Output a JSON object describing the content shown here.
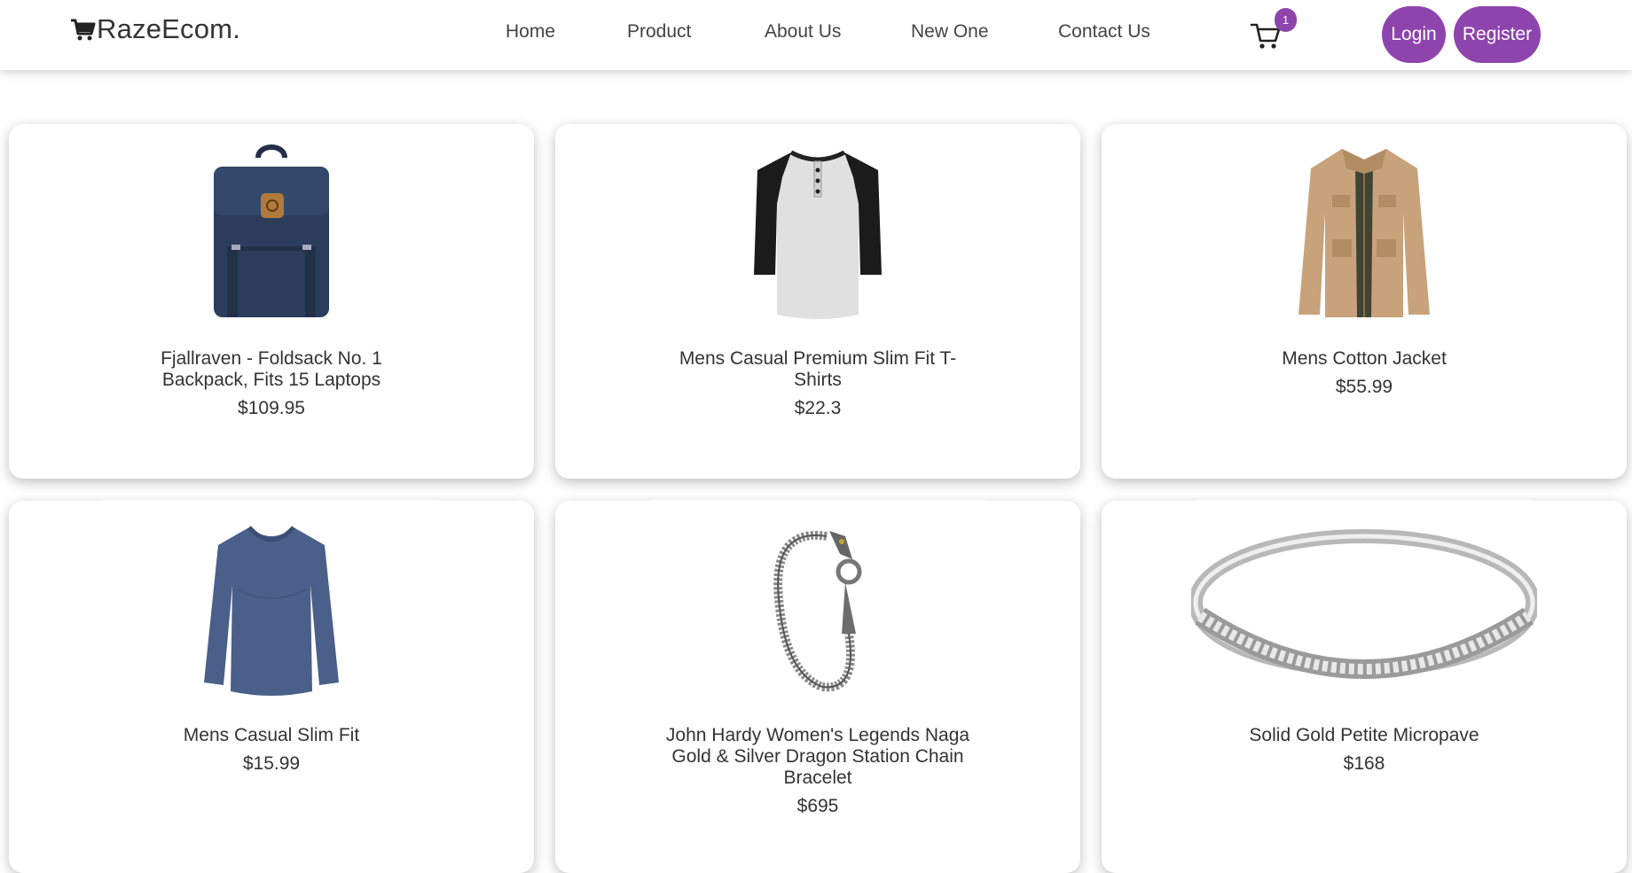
{
  "brand": {
    "name": "RazeEcom.",
    "icon": "shopping-cart-icon"
  },
  "nav": {
    "links": [
      "Home",
      "Product",
      "About Us",
      "New One",
      "Contact Us"
    ]
  },
  "cart": {
    "icon": "shopping-cart-icon",
    "count": "1"
  },
  "auth": {
    "login_label": "Login",
    "register_label": "Register"
  },
  "colors": {
    "accent": "#8e44ad",
    "text": "#333333",
    "background": "#ffffff"
  },
  "products": [
    {
      "title": "Fjallraven - Foldsack No. 1 Backpack, Fits 15 Laptops",
      "price": "$109.95",
      "image": "backpack-image"
    },
    {
      "title": "Mens Casual Premium Slim Fit T-Shirts",
      "price": "$22.3",
      "image": "henley-shirt-image"
    },
    {
      "title": "Mens Cotton Jacket",
      "price": "$55.99",
      "image": "cotton-jacket-image"
    },
    {
      "title": "Mens Casual Slim Fit",
      "price": "$15.99",
      "image": "long-sleeve-shirt-image"
    },
    {
      "title": "John Hardy Women's Legends Naga Gold & Silver Dragon Station Chain Bracelet",
      "price": "$695",
      "image": "dragon-bracelet-image"
    },
    {
      "title": "Solid Gold Petite Micropave",
      "price": "$168",
      "image": "micropave-ring-image"
    }
  ]
}
